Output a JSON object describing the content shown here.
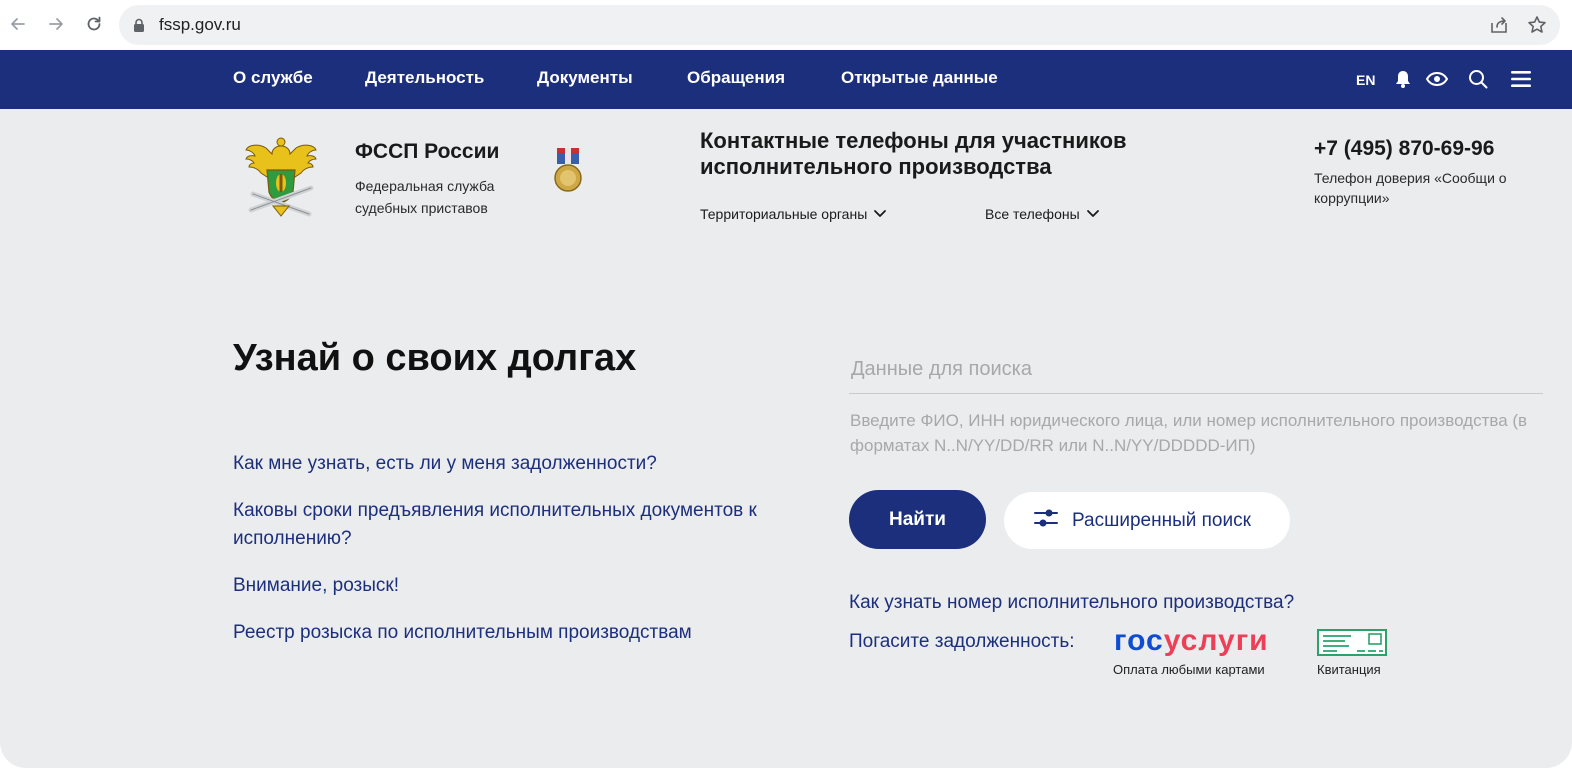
{
  "browser": {
    "url": "fssp.gov.ru"
  },
  "topnav": {
    "items": [
      "О службе",
      "Деятельность",
      "Документы",
      "Обращения",
      "Открытые данные"
    ],
    "lang": "EN",
    "icons": [
      "bell-icon",
      "eye-icon",
      "search-icon",
      "menu-icon"
    ]
  },
  "org": {
    "title": "ФССП России",
    "subtitle": "Федеральная служба судебных приставов"
  },
  "contacts": {
    "title": "Контактные телефоны для участников исполнительного производства",
    "dropdown_territorial": "Территориальные органы",
    "dropdown_all_phones": "Все телефоны",
    "phone": "+7 (495) 870-69-96",
    "phone_caption": "Телефон доверия «Сообщи о коррупции»"
  },
  "main": {
    "title": "Узнай о своих долгах",
    "links": [
      "Как мне узнать, есть ли у меня задолженности?",
      "Каковы сроки предъявления исполнительных документов к исполнению?",
      "Внимание, розыск!",
      "Реестр розыска по исполнительным производствам"
    ]
  },
  "search": {
    "placeholder": "Данные для поиска",
    "hint": "Введите ФИО, ИНН юридического лица, или номер исполнительного производства (в форматах N..N/YY/DD/RR или N..N/YY/DDDDD-ИП)",
    "find_label": "Найти",
    "advanced_label": "Расширенный поиск",
    "howto_link": "Как узнать номер исполнительного производства?",
    "pay_label": "Погасите задолженность:",
    "gosuslugi_part1": "гос",
    "gosuslugi_part2": "услуги",
    "gosuslugi_caption": "Оплата любыми картами",
    "receipt_caption": "Квитанция"
  },
  "colors": {
    "brand_blue": "#1c2f7d",
    "page_bg": "#ebeced",
    "gos_blue": "#0d4cd3",
    "gos_red": "#ee3f58"
  }
}
